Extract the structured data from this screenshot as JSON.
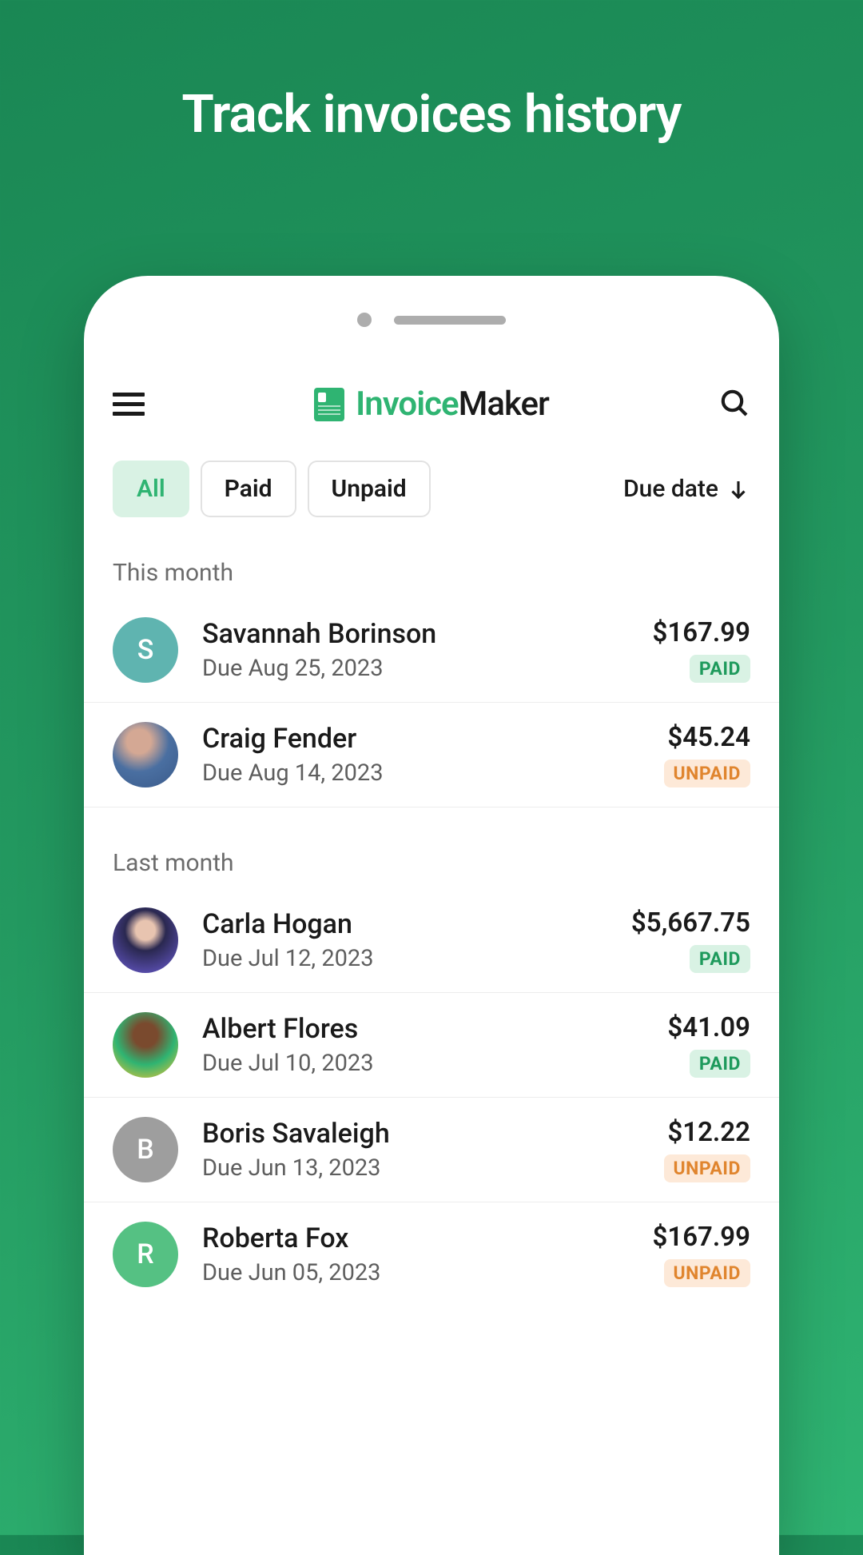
{
  "hero": {
    "title": "Track invoices history"
  },
  "header": {
    "title_part1": "Invoice",
    "title_part2": "Maker"
  },
  "filters": {
    "chips": [
      {
        "label": "All",
        "active": true
      },
      {
        "label": "Paid",
        "active": false
      },
      {
        "label": "Unpaid",
        "active": false
      }
    ],
    "sort_label": "Due date"
  },
  "sections": [
    {
      "label": "This month",
      "rows": [
        {
          "name": "Savannah Borinson",
          "due": "Due Aug 25, 2023",
          "amount": "$167.99",
          "status": "PAID",
          "status_key": "paid",
          "avatar_type": "initial",
          "avatar_initial": "S",
          "avatar_color": "#5fb4b0"
        },
        {
          "name": "Craig Fender",
          "due": "Due Aug 14, 2023",
          "amount": "$45.24",
          "status": "UNPAID",
          "status_key": "unpaid",
          "avatar_type": "photo",
          "avatar_class": "photo-1"
        }
      ]
    },
    {
      "label": "Last month",
      "rows": [
        {
          "name": "Carla Hogan",
          "due": "Due Jul 12, 2023",
          "amount": "$5,667.75",
          "status": "PAID",
          "status_key": "paid",
          "avatar_type": "photo",
          "avatar_class": "photo-2"
        },
        {
          "name": "Albert Flores",
          "due": "Due Jul 10, 2023",
          "amount": "$41.09",
          "status": "PAID",
          "status_key": "paid",
          "avatar_type": "photo",
          "avatar_class": "photo-3"
        },
        {
          "name": "Boris Savaleigh",
          "due": "Due Jun 13, 2023",
          "amount": "$12.22",
          "status": "UNPAID",
          "status_key": "unpaid",
          "avatar_type": "initial",
          "avatar_initial": "B",
          "avatar_color": "#9e9e9e"
        },
        {
          "name": "Roberta Fox",
          "due": "Due Jun 05, 2023",
          "amount": "$167.99",
          "status": "UNPAID",
          "status_key": "unpaid",
          "avatar_type": "initial",
          "avatar_initial": "R",
          "avatar_color": "#55c183"
        }
      ]
    }
  ]
}
